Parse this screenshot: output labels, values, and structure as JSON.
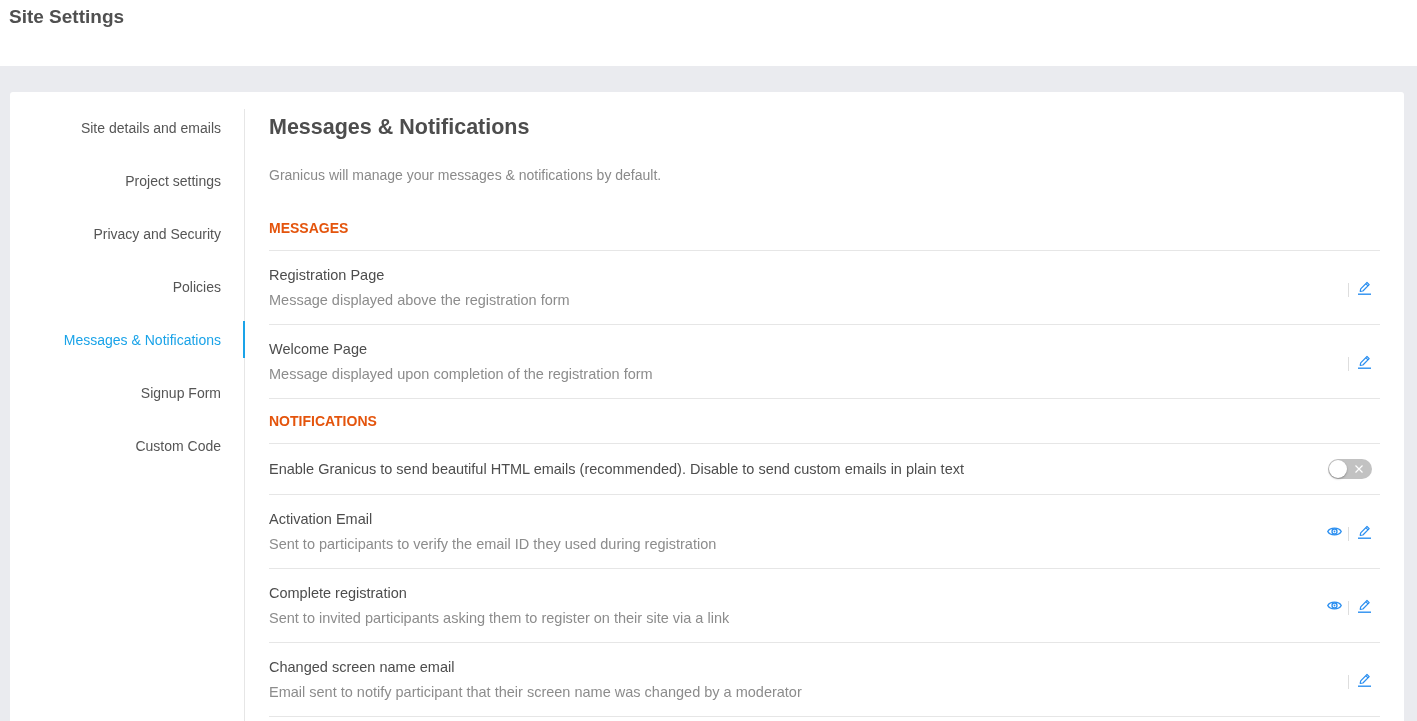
{
  "header": {
    "title": "Site Settings"
  },
  "sidebar": {
    "items": [
      {
        "label": "Site details and emails",
        "selected": false
      },
      {
        "label": "Project settings",
        "selected": false
      },
      {
        "label": "Privacy and Security",
        "selected": false
      },
      {
        "label": "Policies",
        "selected": false
      },
      {
        "label": "Messages & Notifications",
        "selected": true
      },
      {
        "label": "Signup Form",
        "selected": false
      },
      {
        "label": "Custom Code",
        "selected": false
      }
    ]
  },
  "content": {
    "title": "Messages & Notifications",
    "description": "Granicus will manage your messages & notifications by default.",
    "sections": [
      {
        "heading": "MESSAGES",
        "rows": [
          {
            "kind": "message",
            "title": "Registration Page",
            "description": "Message displayed above the registration form",
            "preview": false
          },
          {
            "kind": "message",
            "title": "Welcome Page",
            "description": "Message displayed upon completion of the registration form",
            "preview": false
          }
        ]
      },
      {
        "heading": "NOTIFICATIONS",
        "rows": [
          {
            "kind": "toggle",
            "label": "Enable Granicus to send beautiful HTML emails (recommended). Disable to send custom emails in plain text",
            "on": false
          },
          {
            "kind": "message",
            "title": "Activation Email",
            "description": "Sent to participants to verify the email ID they used during registration",
            "preview": true
          },
          {
            "kind": "message",
            "title": "Complete registration",
            "description": "Sent to invited participants asking them to register on their site via a link",
            "preview": true
          },
          {
            "kind": "message",
            "title": "Changed screen name email",
            "description": "Email sent to notify participant that their screen name was changed by a moderator",
            "preview": false
          }
        ]
      }
    ]
  }
}
